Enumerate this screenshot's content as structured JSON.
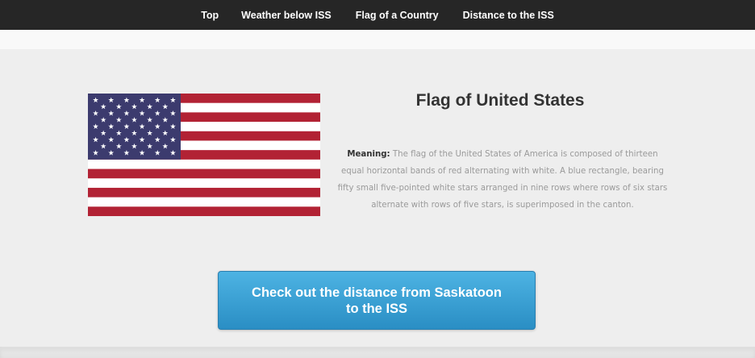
{
  "nav": {
    "items": [
      {
        "label": "Top"
      },
      {
        "label": "Weather below ISS"
      },
      {
        "label": "Flag of a Country"
      },
      {
        "label": "Distance to the ISS"
      }
    ]
  },
  "flag": {
    "country": "United States",
    "title": "Flag of United States",
    "stripes": 13,
    "star_rows": 9,
    "colors": {
      "red": "#b22234",
      "white": "#ffffff",
      "blue": "#3c3b6e"
    }
  },
  "meaning": {
    "label": "Meaning:",
    "text": "The flag of the United States of America is composed of thirteen equal horizontal bands of red alternating with white. A blue rectangle, bearing fifty small five-pointed white stars arranged in nine rows where rows of six stars alternate with rows of five stars, is superimposed in the canton."
  },
  "cta": {
    "line1": "Check out the distance from Saskatoon",
    "line2": "to the ISS",
    "color": "#3ba2d6"
  }
}
